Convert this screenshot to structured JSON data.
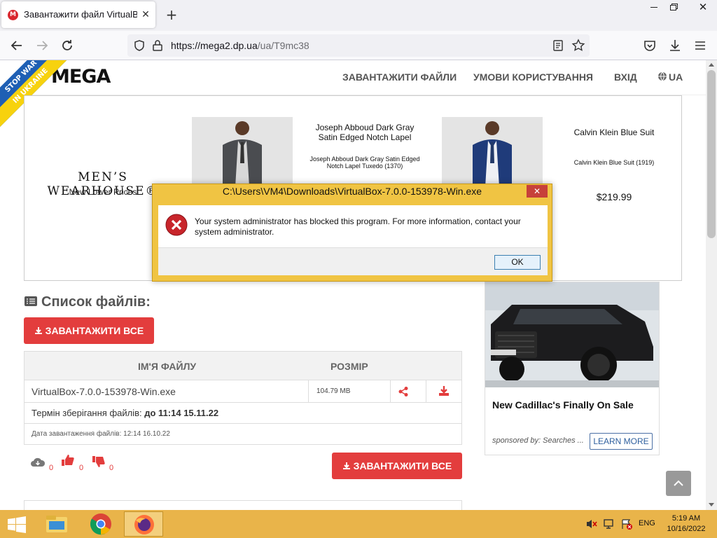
{
  "browser": {
    "tab_title": "Завантажити файл VirtualBox-",
    "tab_favicon": "M",
    "url_host": "https://mega2.dp.ua",
    "url_path": "/ua/T9mc38"
  },
  "site": {
    "logo": "MEGA",
    "banner_line1": "STOP WAR",
    "banner_line2": "IN UKRAINE",
    "menu": [
      "ЗАВАНТАЖИТИ ФАЙЛИ",
      "УМОВИ КОРИСТУВАННЯ",
      "ВХІД",
      "UA"
    ]
  },
  "ad_mens": {
    "brand": "MEN’S WEARHOUSE®",
    "tagline": "New Lower Prices",
    "product1_title": "Joseph Abboud Dark Gray Satin Edged Notch Lapel",
    "product1_sub": "Joseph Abboud Dark Gray Satin Edged Notch Lapel Tuxedo (1370)",
    "product2_title": "Calvin Klein Blue Suit",
    "product2_sub": "Calvin Klein Blue Suit (1919)",
    "product2_price": "$219.99"
  },
  "files": {
    "heading": "Список файлів:",
    "download_all": "ЗАВАНТАЖИТИ ВСЕ",
    "col_name": "ІМ'Я ФАЙЛУ",
    "col_size": "РОЗМІР",
    "file_name": "VirtualBox-7.0.0-153978-Win.exe",
    "file_size": "104.79 MB",
    "retention_label": "Термін зберігання файлів: ",
    "retention_value": "до 11:14 15.11.22",
    "upload_date": "Дата завантаження файлів: 12:14 16.10.22",
    "downloads_count": "0",
    "likes_count": "0",
    "dislikes_count": "0"
  },
  "ad_cadillac": {
    "title": "New Cadillac's Finally On Sale",
    "sponsor": "sponsored by: Searches ...",
    "cta": "LEARN MORE"
  },
  "dialog": {
    "title": "C:\\Users\\VM4\\Downloads\\VirtualBox-7.0.0-153978-Win.exe",
    "message": "Your system administrator has blocked this program. For more information, contact your system administrator.",
    "ok": "OK",
    "close": "✕"
  },
  "taskbar": {
    "lang": "ENG",
    "time": "5:19 AM",
    "date": "10/16/2022"
  },
  "colors": {
    "accent_red": "#e33d3d",
    "dialog_frame": "#f0c443",
    "taskbar": "#e9b44a"
  }
}
